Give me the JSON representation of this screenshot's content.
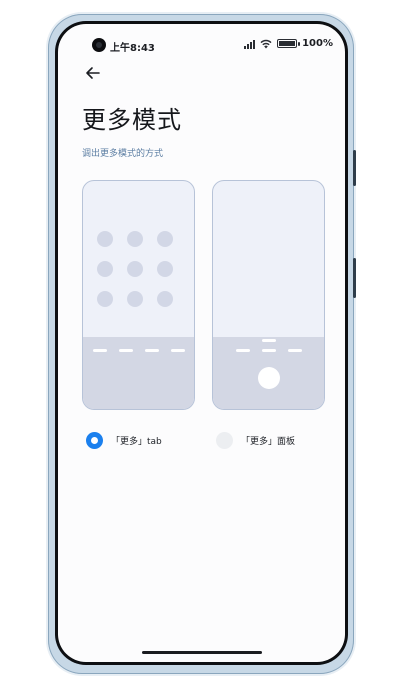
{
  "status_bar": {
    "time": "上午8:43",
    "battery": "100",
    "battery_level": 1.0
  },
  "header": {
    "back_icon": "arrow-left-icon",
    "title": "更多模式",
    "subtitle": "调出更多模式的方式"
  },
  "options": [
    {
      "label": "「更多」tab",
      "selected": true
    },
    {
      "label": "「更多」面板",
      "selected": false
    }
  ],
  "colors": {
    "accent": "#1b80ee",
    "subtitle": "#5c7ea3",
    "card_border": "#b7c3d8",
    "card_fill": "#eef1f9",
    "card_bottom": "#d3d7e4"
  }
}
